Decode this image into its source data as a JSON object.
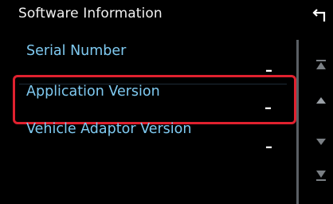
{
  "header": {
    "title": "Software Information",
    "back_icon": "return-arrow-icon"
  },
  "rows": [
    {
      "label": "Serial Number",
      "value": "–"
    },
    {
      "label": "Application Version",
      "value": "–",
      "selected": true
    },
    {
      "label": "Vehicle Adaptor Version",
      "value": "–"
    }
  ],
  "scroll": {
    "icons": [
      "scroll-top-icon",
      "scroll-up-icon",
      "scroll-down-icon",
      "scroll-bottom-icon"
    ]
  },
  "colors": {
    "background": "#000000",
    "label": "#7fcaf1",
    "title": "#f2f2f2",
    "selection": "#e0212f",
    "scroll_track": "#5a5f64"
  }
}
